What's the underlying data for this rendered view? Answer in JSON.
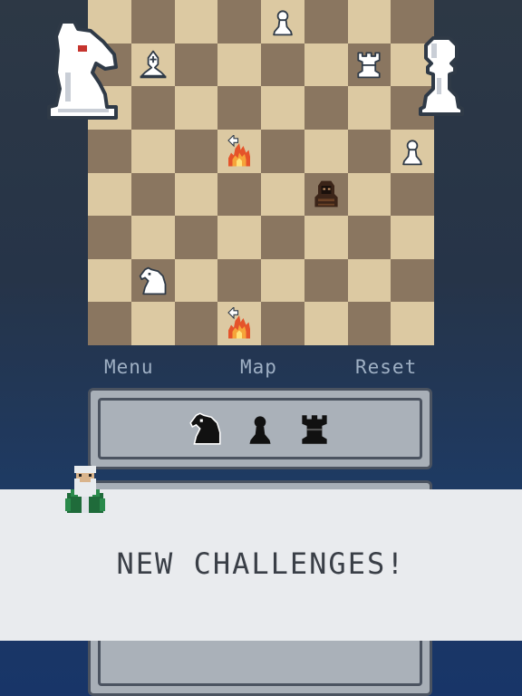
{
  "menu": {
    "menu_label": "Menu",
    "map_label": "Map",
    "reset_label": "Reset"
  },
  "board": {
    "light_color": "#dcc9a2",
    "dark_color": "#8a7660",
    "pieces": [
      {
        "name": "white-pawn-a",
        "type": "pawn",
        "color": "white",
        "square": "e8"
      },
      {
        "name": "white-bishop",
        "type": "bishop",
        "color": "white",
        "square": "b7"
      },
      {
        "name": "white-rook",
        "type": "rook",
        "color": "white",
        "square": "g7"
      },
      {
        "name": "white-pawn-b",
        "type": "pawn",
        "color": "white",
        "square": "h5"
      },
      {
        "name": "hooded-figure",
        "type": "hooded",
        "color": "black",
        "square": "f4"
      },
      {
        "name": "white-knight",
        "type": "knight",
        "color": "white",
        "square": "b2"
      }
    ],
    "hazards": [
      {
        "name": "fire-hazard-1",
        "square": "d5"
      },
      {
        "name": "fire-hazard-2",
        "square": "d1"
      }
    ]
  },
  "captured": {
    "icons": [
      "knight-icon",
      "pawn-icon",
      "rook-icon"
    ]
  },
  "banner": {
    "text": "NEW CHALLENGES!"
  }
}
